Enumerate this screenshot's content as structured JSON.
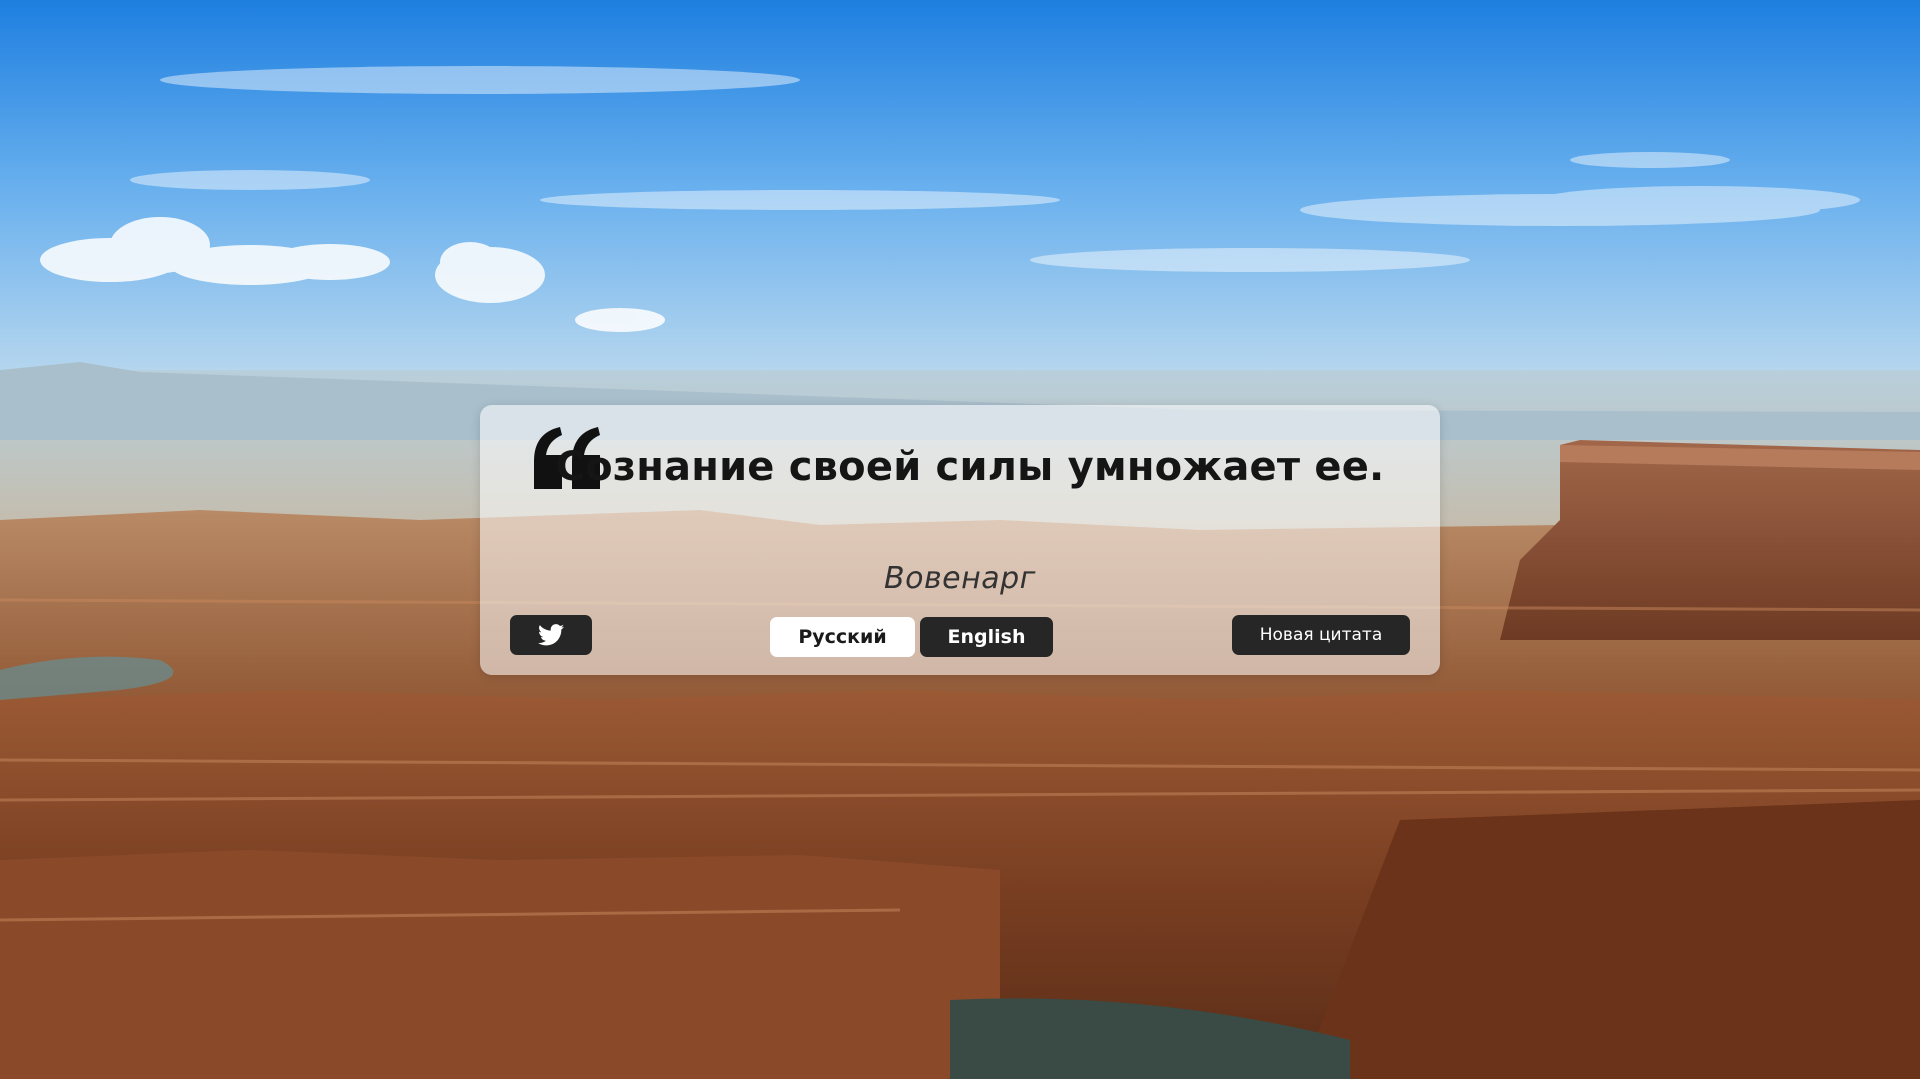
{
  "background": {
    "description_icon": "canyon-landscape-photo"
  },
  "quote": {
    "text": "Сознание своей силы умножает ее.",
    "author": "Вовенарг",
    "quote_icon": "left-double-quote-icon"
  },
  "buttons": {
    "twitter_icon": "twitter-bird-icon",
    "lang_ru": "Русский",
    "lang_en": "English",
    "new_quote": "Новая цитата"
  },
  "colors": {
    "button_dark": "#262626",
    "button_light": "#ffffff",
    "card_bg": "rgba(255,255,255,0.55)",
    "text_dark": "#151515"
  }
}
